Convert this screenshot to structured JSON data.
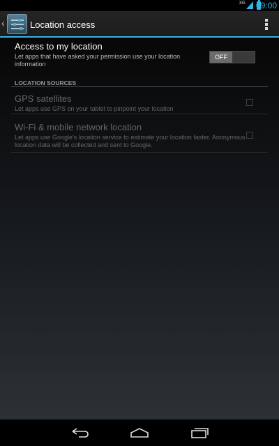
{
  "status_bar": {
    "network": "3G",
    "time": "09:00",
    "accent_color": "#33b5e5"
  },
  "action_bar": {
    "title": "Location access",
    "app_icon": "settings-sliders-icon",
    "overflow_icon": "overflow-menu-icon"
  },
  "access_pref": {
    "title": "Access to my location",
    "summary": "Let apps that have asked your permission use your location information",
    "toggle_label": "OFF",
    "enabled": false
  },
  "location_sources": {
    "header": "LOCATION SOURCES",
    "items": [
      {
        "title": "GPS satellites",
        "summary": "Let apps use GPS on your tablet to pinpoint your location",
        "checked": false,
        "disabled": true
      },
      {
        "title": "Wi-Fi & mobile network location",
        "summary": "Let apps use Google's location service to estimate your location faster. Anonymous location data will be collected and sent to Google.",
        "checked": false,
        "disabled": true
      }
    ]
  },
  "nav_bar": {
    "back_icon": "back-icon",
    "home_icon": "home-icon",
    "recents_icon": "recent-apps-icon"
  }
}
